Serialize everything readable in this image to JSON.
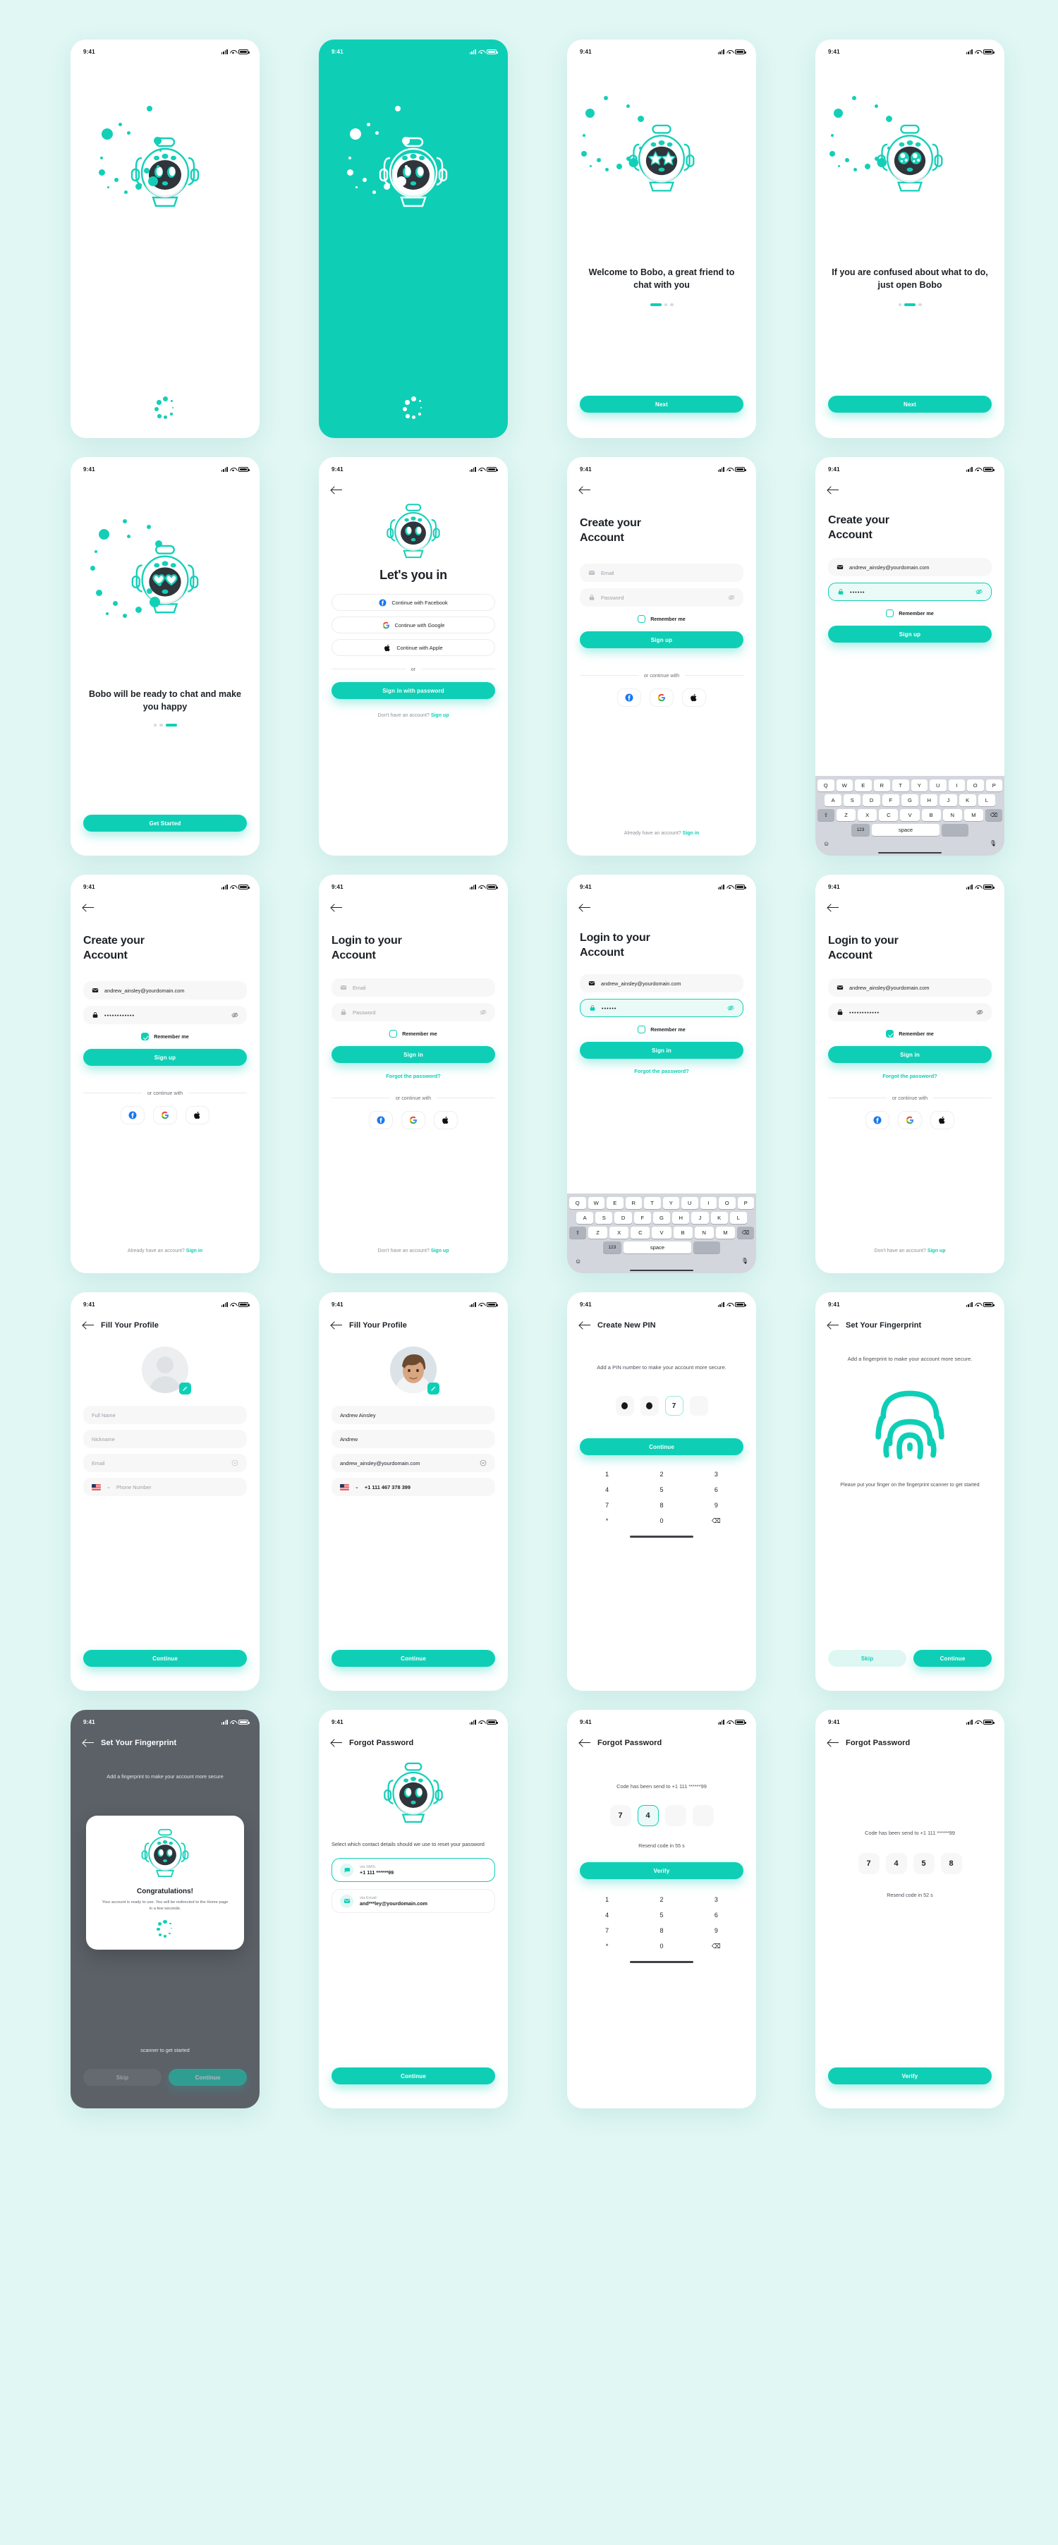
{
  "meta": {
    "app_name": "Bobo",
    "accent": "#0ECFB6",
    "dark": "#1d2126",
    "bg": "#e0f7f4",
    "status_time": "9:41"
  },
  "screens": [
    {
      "id": "splash-light",
      "type": "splash",
      "theme": "light"
    },
    {
      "id": "splash-teal",
      "type": "splash",
      "theme": "teal"
    },
    {
      "id": "onboarding-1",
      "type": "onboarding",
      "headline": "Welcome to Bobo, a great friend to chat with you",
      "button": "Next",
      "page_index": 0,
      "page_count": 3,
      "face": "stars"
    },
    {
      "id": "onboarding-2",
      "type": "onboarding",
      "headline": "If you are confused about what to do, just open Bobo",
      "button": "Next",
      "page_index": 1,
      "page_count": 3,
      "face": "sparkle"
    },
    {
      "id": "onboarding-3",
      "type": "onboarding",
      "headline": "Bobo will be ready to chat and make you happy",
      "button": "Get Started",
      "page_index": 2,
      "page_count": 3,
      "face": "hearts"
    },
    {
      "id": "lets-you-in",
      "type": "lets-you-in",
      "title": "Let's you in",
      "sso": [
        {
          "label": "Continue with Facebook",
          "icon": "facebook-icon"
        },
        {
          "label": "Continue with Google",
          "icon": "google-icon"
        },
        {
          "label": "Continue with Apple",
          "icon": "apple-icon"
        }
      ],
      "divider": "or",
      "primary_button": "Sign in with password",
      "footer_text": "Don't have an account?",
      "footer_link": "Sign up"
    },
    {
      "id": "signup-empty",
      "type": "auth",
      "title": "Create your Account",
      "email": {
        "value": "",
        "placeholder": "Email"
      },
      "password": {
        "value": "",
        "placeholder": "Password"
      },
      "remember_label": "Remember me",
      "remember_checked": false,
      "submit": "Sign up",
      "divider": "or continue with",
      "footer_text": "Already have an account?",
      "footer_link": "Sign in",
      "forgot": "",
      "keyboard": false,
      "active_field": ""
    },
    {
      "id": "signup-typing",
      "type": "auth",
      "title": "Create your Account",
      "email": {
        "value": "andrew_ainsley@yourdomain.com",
        "placeholder": "Email"
      },
      "password": {
        "value": "••••••",
        "placeholder": "Password"
      },
      "remember_label": "Remember me",
      "remember_checked": false,
      "submit": "Sign up",
      "divider": "or continue with",
      "footer_text": "Already have an account?",
      "footer_link": "Sign in",
      "forgot": "",
      "keyboard": true,
      "active_field": "password"
    },
    {
      "id": "signup-filled",
      "type": "auth",
      "title": "Create your Account",
      "email": {
        "value": "andrew_ainsley@yourdomain.com",
        "placeholder": "Email"
      },
      "password": {
        "value": "••••••••••••",
        "placeholder": "Password"
      },
      "remember_label": "Remember me",
      "remember_checked": true,
      "submit": "Sign up",
      "divider": "or continue with",
      "footer_text": "Already have an account?",
      "footer_link": "Sign in",
      "forgot": "",
      "keyboard": false,
      "active_field": ""
    },
    {
      "id": "login-empty",
      "type": "auth",
      "title": "Login to your Account",
      "email": {
        "value": "",
        "placeholder": "Email"
      },
      "password": {
        "value": "",
        "placeholder": "Password"
      },
      "remember_label": "Remember me",
      "remember_checked": false,
      "submit": "Sign in",
      "forgot": "Forgot the password?",
      "divider": "or continue with",
      "footer_text": "Don't have an account?",
      "footer_link": "Sign up",
      "keyboard": false,
      "active_field": ""
    },
    {
      "id": "login-typing",
      "type": "auth",
      "title": "Login to your Account",
      "email": {
        "value": "andrew_ainsley@yourdomain.com",
        "placeholder": "Email"
      },
      "password": {
        "value": "••••••",
        "placeholder": "Password"
      },
      "remember_label": "Remember me",
      "remember_checked": false,
      "submit": "Sign in",
      "forgot": "Forgot the password?",
      "divider": "or continue with",
      "footer_text": "Don't have an account?",
      "footer_link": "Sign up",
      "keyboard": true,
      "active_field": "password"
    },
    {
      "id": "login-filled",
      "type": "auth",
      "title": "Login to your Account",
      "email": {
        "value": "andrew_ainsley@yourdomain.com",
        "placeholder": "Email"
      },
      "password": {
        "value": "••••••••••••",
        "placeholder": "Password"
      },
      "remember_label": "Remember me",
      "remember_checked": true,
      "submit": "Sign in",
      "forgot": "Forgot the password?",
      "divider": "or continue with",
      "footer_text": "Don't have an account?",
      "footer_link": "Sign up",
      "keyboard": false,
      "active_field": ""
    },
    {
      "id": "profile-empty",
      "type": "profile",
      "nav_title": "Fill Your Profile",
      "fields": [
        {
          "value": "",
          "placeholder": "Full Name",
          "icon": ""
        },
        {
          "value": "",
          "placeholder": "Nickname",
          "icon": ""
        },
        {
          "value": "",
          "placeholder": "Email",
          "icon": "chevron-down-icon"
        },
        {
          "value": "",
          "placeholder": "Phone Number",
          "icon": "flag-us-icon"
        }
      ],
      "button": "Continue",
      "has_photo": false
    },
    {
      "id": "profile-filled",
      "type": "profile",
      "nav_title": "Fill Your Profile",
      "fields": [
        {
          "value": "Andrew Ainsley",
          "placeholder": "Full Name",
          "icon": ""
        },
        {
          "value": "Andrew",
          "placeholder": "Nickname",
          "icon": ""
        },
        {
          "value": "andrew_ainsley@yourdomain.com",
          "placeholder": "Email",
          "icon": "chevron-down-icon"
        },
        {
          "value": "+1 111 467 378 399",
          "placeholder": "Phone Number",
          "icon": "flag-us-icon"
        }
      ],
      "button": "Continue",
      "has_photo": true
    },
    {
      "id": "create-pin",
      "type": "pin",
      "nav_title": "Create New PIN",
      "subtitle": "Add a PIN number to make your account more secure.",
      "pin_boxes": [
        "dot",
        "dot",
        "7",
        ""
      ],
      "button": "Continue",
      "keypad": [
        "1",
        "2",
        "3",
        "4",
        "5",
        "6",
        "7",
        "8",
        "9",
        "*",
        "0",
        "del"
      ]
    },
    {
      "id": "fingerprint",
      "type": "fingerprint",
      "nav_title": "Set Your Fingerprint",
      "subtitle": "Add a fingerprint to make your account more secure.",
      "hint": "Please put your finger on the fingerprint scanner to get started",
      "skip": "Skip",
      "continue": "Continue"
    },
    {
      "id": "fingerprint-congrats",
      "type": "congrats",
      "nav_title": "Set Your Fingerprint",
      "subtitle": "Add a fingerprint to make your account more secure",
      "hint": "scanner to get started",
      "modal_title": "Congratulations!",
      "modal_body": "Your account is ready to use. You will be redirected to the Home page in a few seconds.",
      "skip": "Skip",
      "continue": "Continue"
    },
    {
      "id": "forgot-select",
      "type": "forgot-select",
      "nav_title": "Forgot Password",
      "subtitle": "Select which contact details should we use to reset your password",
      "options": [
        {
          "label": "via SMS:",
          "value": "+1 111 ******99",
          "icon": "chat-icon",
          "selected": true
        },
        {
          "label": "via Email:",
          "value": "and***ley@yourdomain.com",
          "icon": "mail-icon",
          "selected": false
        }
      ],
      "button": "Continue"
    },
    {
      "id": "otp-typing",
      "type": "otp",
      "nav_title": "Forgot Password",
      "subtitle": "Code has been send to +1 111 ******99",
      "boxes": [
        "7",
        "4",
        "",
        ""
      ],
      "active_index": 1,
      "resend": "Resend code in 55 s",
      "resend_count": "55",
      "button": "Verify",
      "keypad": [
        "1",
        "2",
        "3",
        "4",
        "5",
        "6",
        "7",
        "8",
        "9",
        "*",
        "0",
        "del"
      ],
      "has_keypad": true
    },
    {
      "id": "otp-complete",
      "type": "otp",
      "nav_title": "Forgot Password",
      "subtitle": "Code has been send to +1 111 ******99",
      "boxes": [
        "7",
        "4",
        "5",
        "8"
      ],
      "active_index": -1,
      "resend": "Resend code in 52 s",
      "resend_count": "52",
      "button": "Verify",
      "keypad": [],
      "has_keypad": false
    }
  ]
}
